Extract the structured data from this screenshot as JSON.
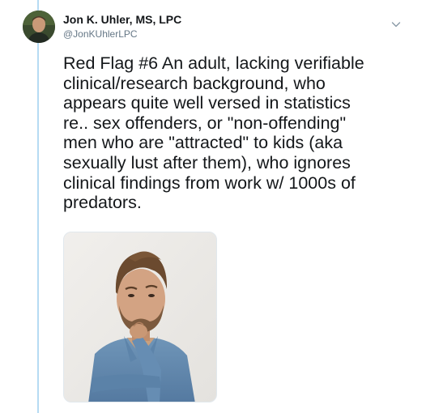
{
  "author": {
    "display_name": "Jon K. Uhler, MS, LPC",
    "handle": "@JonKUhlerLPC"
  },
  "tweet": {
    "text": "Red Flag #6 An adult, lacking verifiable\nclinical/research background, who\nappears quite well versed in statistics\nre.. sex offenders, or \"non-offending\"\nmen who are \"attracted\" to kids (aka\nsexually lust after them), who ignores\nclinical findings from work w/ 1000s of\npredators."
  },
  "icons": {
    "menu": "chevron-down-icon"
  },
  "colors": {
    "thread_line": "#b6dbf3",
    "name_text": "#14171a",
    "handle_text": "#657786",
    "caret": "#8899a6"
  }
}
